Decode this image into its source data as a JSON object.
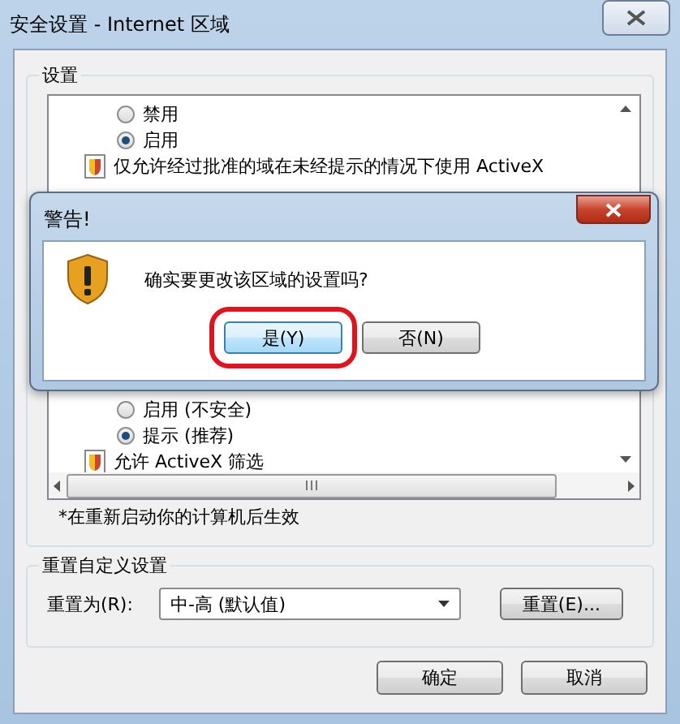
{
  "window": {
    "title": "安全设置 - Internet 区域"
  },
  "settings": {
    "label": "设置",
    "rows_top": [
      {
        "kind": "radio",
        "label": "禁用",
        "selected": false
      },
      {
        "kind": "radio",
        "label": "启用",
        "selected": true
      },
      {
        "kind": "heading",
        "label": "仅允许经过批准的域在未经提示的情况下使用 ActiveX"
      }
    ],
    "rows_bottom": [
      {
        "kind": "radio",
        "label": "启用 (不安全)",
        "selected": false
      },
      {
        "kind": "radio",
        "label": "提示 (推荐)",
        "selected": true
      },
      {
        "kind": "heading",
        "label": "允许 ActiveX 筛选"
      }
    ]
  },
  "note": "*在重新启动你的计算机后生效",
  "reset": {
    "label": "重置自定义设置",
    "field_label": "重置为(R):",
    "value": "中-高 (默认值)",
    "button": "重置(E)..."
  },
  "buttons": [
    "确定",
    "取消"
  ],
  "alert": {
    "title": "警告!",
    "message": "确实要更改该区域的设置吗?",
    "buttons": [
      {
        "label": "是(Y)",
        "highlighted": true
      },
      {
        "label": "否(N)",
        "highlighted": false
      }
    ]
  }
}
